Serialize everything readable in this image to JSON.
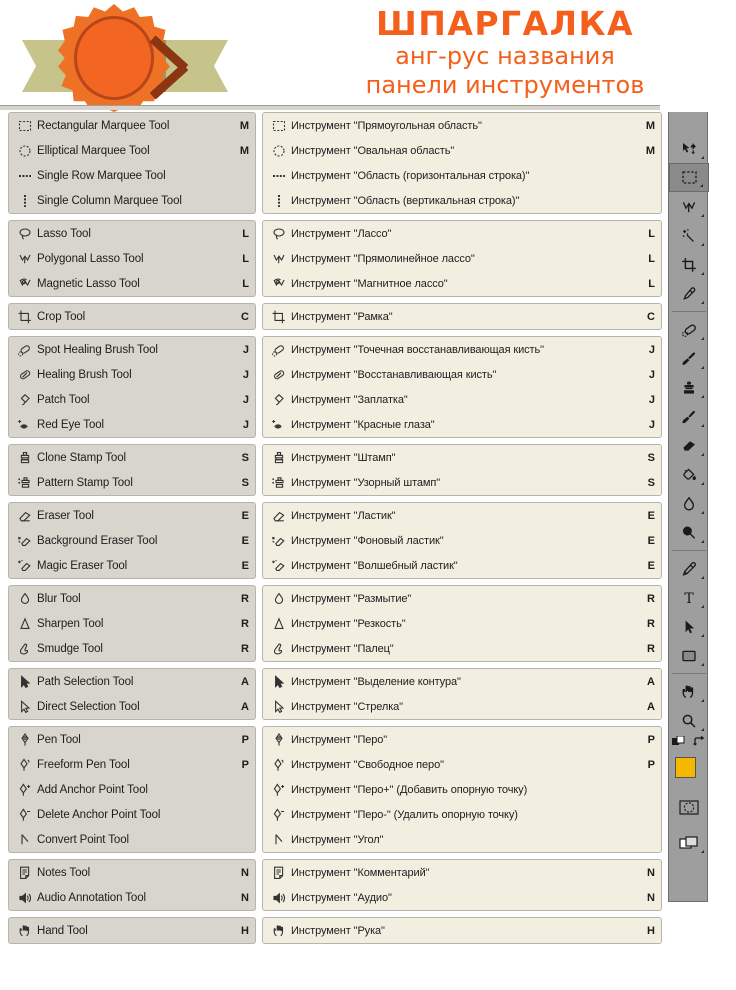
{
  "header": {
    "title_line1": "ШПАРГАЛКА",
    "title_line2": "анг-рус названия",
    "title_line3": "панели инструментов",
    "logo_name": "paintbrush-pencil-badge",
    "accent_color": "#f4601c",
    "badge_color": "#f26522",
    "ribbon_color": "#c6c48b"
  },
  "toolbar": {
    "collapse_label": "»",
    "items": [
      {
        "name": "move-tool",
        "glyph": "move"
      },
      {
        "name": "rectangular-marquee-tool",
        "glyph": "marquee",
        "selected": true
      },
      {
        "name": "lasso-tool",
        "glyph": "lasso"
      },
      {
        "name": "magic-wand-tool",
        "glyph": "wand"
      },
      {
        "name": "crop-tool",
        "glyph": "crop"
      },
      {
        "name": "eyedropper-tool",
        "glyph": "eyedropper"
      },
      {
        "name": "healing-brush-tool",
        "glyph": "healing"
      },
      {
        "name": "brush-tool",
        "glyph": "brush"
      },
      {
        "name": "clone-stamp-tool",
        "glyph": "stamp"
      },
      {
        "name": "history-brush-tool",
        "glyph": "historybrush"
      },
      {
        "name": "eraser-tool",
        "glyph": "eraser"
      },
      {
        "name": "paint-bucket-tool",
        "glyph": "bucket"
      },
      {
        "name": "blur-tool",
        "glyph": "blur"
      },
      {
        "name": "dodge-tool",
        "glyph": "dodge"
      },
      {
        "name": "pen-tool",
        "glyph": "pen"
      },
      {
        "name": "type-tool",
        "glyph": "type"
      },
      {
        "name": "path-selection-tool",
        "glyph": "arrow"
      },
      {
        "name": "shape-tool",
        "glyph": "rect"
      },
      {
        "name": "hand-tool",
        "glyph": "hand"
      },
      {
        "name": "zoom-tool",
        "glyph": "zoom"
      }
    ],
    "foreground_color": "#f5b800",
    "background_color": "#f8cfd2",
    "quickmask_name": "quick-mask-toggle",
    "screenmode_name": "screen-mode-toggle",
    "swap_name": "swap-colors-icon",
    "default_name": "default-colors-icon"
  },
  "groups": [
    {
      "id": "marquee",
      "rows": [
        {
          "icon": "rectangular-marquee-icon",
          "en": "Rectangular Marquee Tool",
          "ru": "Инструмент \"Прямоугольная область\"",
          "key": "M"
        },
        {
          "icon": "elliptical-marquee-icon",
          "en": "Elliptical Marquee Tool",
          "ru": "Инструмент \"Овальная область\"",
          "key": "M"
        },
        {
          "icon": "single-row-marquee-icon",
          "en": "Single Row Marquee Tool",
          "ru": "Инструмент \"Область (горизонтальная строка)\"",
          "key": ""
        },
        {
          "icon": "single-column-marquee-icon",
          "en": "Single Column Marquee Tool",
          "ru": "Инструмент \"Область (вертикальная строка)\"",
          "key": ""
        }
      ]
    },
    {
      "id": "lasso",
      "rows": [
        {
          "icon": "lasso-icon",
          "en": "Lasso Tool",
          "ru": "Инструмент \"Лассо\"",
          "key": "L"
        },
        {
          "icon": "polygonal-lasso-icon",
          "en": "Polygonal Lasso Tool",
          "ru": "Инструмент \"Прямолинейное лассо\"",
          "key": "L"
        },
        {
          "icon": "magnetic-lasso-icon",
          "en": "Magnetic Lasso Tool",
          "ru": "Инструмент \"Магнитное лассо\"",
          "key": "L"
        }
      ]
    },
    {
      "id": "crop",
      "rows": [
        {
          "icon": "crop-icon",
          "en": "Crop Tool",
          "ru": "Инструмент \"Рамка\"",
          "key": "C"
        }
      ]
    },
    {
      "id": "healing",
      "rows": [
        {
          "icon": "spot-healing-brush-icon",
          "en": "Spot Healing Brush Tool",
          "ru": "Инструмент \"Точечная восстанавливающая кисть\"",
          "key": "J"
        },
        {
          "icon": "healing-brush-icon",
          "en": "Healing Brush Tool",
          "ru": "Инструмент \"Восстанавливающая кисть\"",
          "key": "J"
        },
        {
          "icon": "patch-icon",
          "en": "Patch Tool",
          "ru": "Инструмент \"Заплатка\"",
          "key": "J"
        },
        {
          "icon": "red-eye-icon",
          "en": "Red Eye Tool",
          "ru": "Инструмент \"Красные глаза\"",
          "key": "J"
        }
      ]
    },
    {
      "id": "stamp",
      "rows": [
        {
          "icon": "clone-stamp-icon",
          "en": "Clone Stamp Tool",
          "ru": "Инструмент \"Штамп\"",
          "key": "S"
        },
        {
          "icon": "pattern-stamp-icon",
          "en": "Pattern Stamp Tool",
          "ru": "Инструмент \"Узорный штамп\"",
          "key": "S"
        }
      ]
    },
    {
      "id": "eraser",
      "rows": [
        {
          "icon": "eraser-icon",
          "en": "Eraser Tool",
          "ru": "Инструмент \"Ластик\"",
          "key": "E"
        },
        {
          "icon": "background-eraser-icon",
          "en": "Background Eraser Tool",
          "ru": "Инструмент \"Фоновый ластик\"",
          "key": "E"
        },
        {
          "icon": "magic-eraser-icon",
          "en": "Magic Eraser Tool",
          "ru": "Инструмент \"Волшебный ластик\"",
          "key": "E"
        }
      ]
    },
    {
      "id": "blur",
      "rows": [
        {
          "icon": "blur-icon",
          "en": "Blur Tool",
          "ru": "Инструмент \"Размытие\"",
          "key": "R"
        },
        {
          "icon": "sharpen-icon",
          "en": "Sharpen Tool",
          "ru": "Инструмент \"Резкость\"",
          "key": "R"
        },
        {
          "icon": "smudge-icon",
          "en": "Smudge Tool",
          "ru": "Инструмент \"Палец\"",
          "key": "R"
        }
      ]
    },
    {
      "id": "selection",
      "rows": [
        {
          "icon": "path-selection-icon",
          "en": "Path Selection Tool",
          "ru": "Инструмент \"Выделение контура\"",
          "key": "A"
        },
        {
          "icon": "direct-selection-icon",
          "en": "Direct Selection Tool",
          "ru": "Инструмент \"Стрелка\"",
          "key": "A"
        }
      ]
    },
    {
      "id": "pen",
      "rows": [
        {
          "icon": "pen-icon",
          "en": "Pen Tool",
          "ru": "Инструмент \"Перо\"",
          "key": "P"
        },
        {
          "icon": "freeform-pen-icon",
          "en": "Freeform Pen Tool",
          "ru": "Инструмент \"Свободное перо\"",
          "key": "P"
        },
        {
          "icon": "add-anchor-point-icon",
          "en": "Add Anchor Point Tool",
          "ru": "Инструмент \"Перо+\" (Добавить опорную точку)",
          "key": ""
        },
        {
          "icon": "delete-anchor-point-icon",
          "en": "Delete Anchor Point Tool",
          "ru": "Инструмент \"Перо-\" (Удалить опорную точку)",
          "key": ""
        },
        {
          "icon": "convert-point-icon",
          "en": "Convert Point Tool",
          "ru": "Инструмент \"Угол\"",
          "key": ""
        }
      ]
    },
    {
      "id": "notes",
      "rows": [
        {
          "icon": "notes-icon",
          "en": "Notes Tool",
          "ru": "Инструмент \"Комментарий\"",
          "key": "N"
        },
        {
          "icon": "audio-annotation-icon",
          "en": "Audio Annotation Tool",
          "ru": "Инструмент \"Аудио\"",
          "key": "N"
        }
      ]
    },
    {
      "id": "hand",
      "rows": [
        {
          "icon": "hand-icon",
          "en": "Hand Tool",
          "ru": "Инструмент \"Рука\"",
          "key": "H"
        }
      ]
    }
  ]
}
